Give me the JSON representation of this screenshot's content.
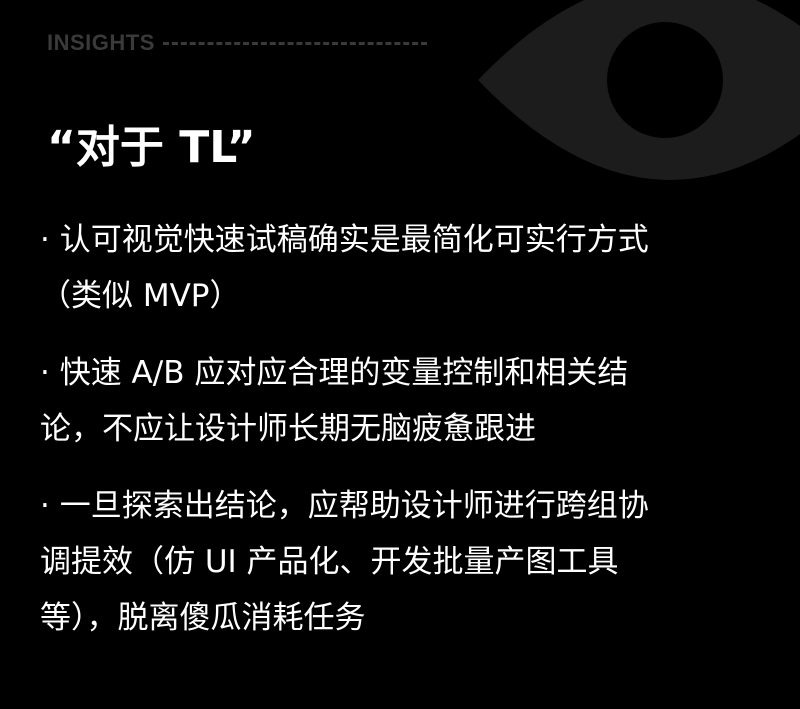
{
  "header": {
    "label": "INSIGHTS"
  },
  "title": "“对于 TL”",
  "points": [
    {
      "lines": [
        "· 认可视觉快速试稿确实是最简化可实行方式",
        "（类似 MVP）"
      ]
    },
    {
      "lines": [
        "· 快速 A/B 应对应合理的变量控制和相关结",
        "论，不应让设计师长期无脑疲惫跟进"
      ]
    },
    {
      "lines": [
        "· 一旦探索出结论，应帮助设计师进行跨组协",
        "调提效（仿 UI 产品化、开发批量产图工具",
        "等），脱离傻瓜消耗任务"
      ]
    }
  ],
  "colors": {
    "background": "#000000",
    "text": "#ffffff",
    "muted": "#3a3a3a",
    "eye_shape": "#1c1c1c"
  },
  "decoration": {
    "icon": "eye-icon"
  }
}
